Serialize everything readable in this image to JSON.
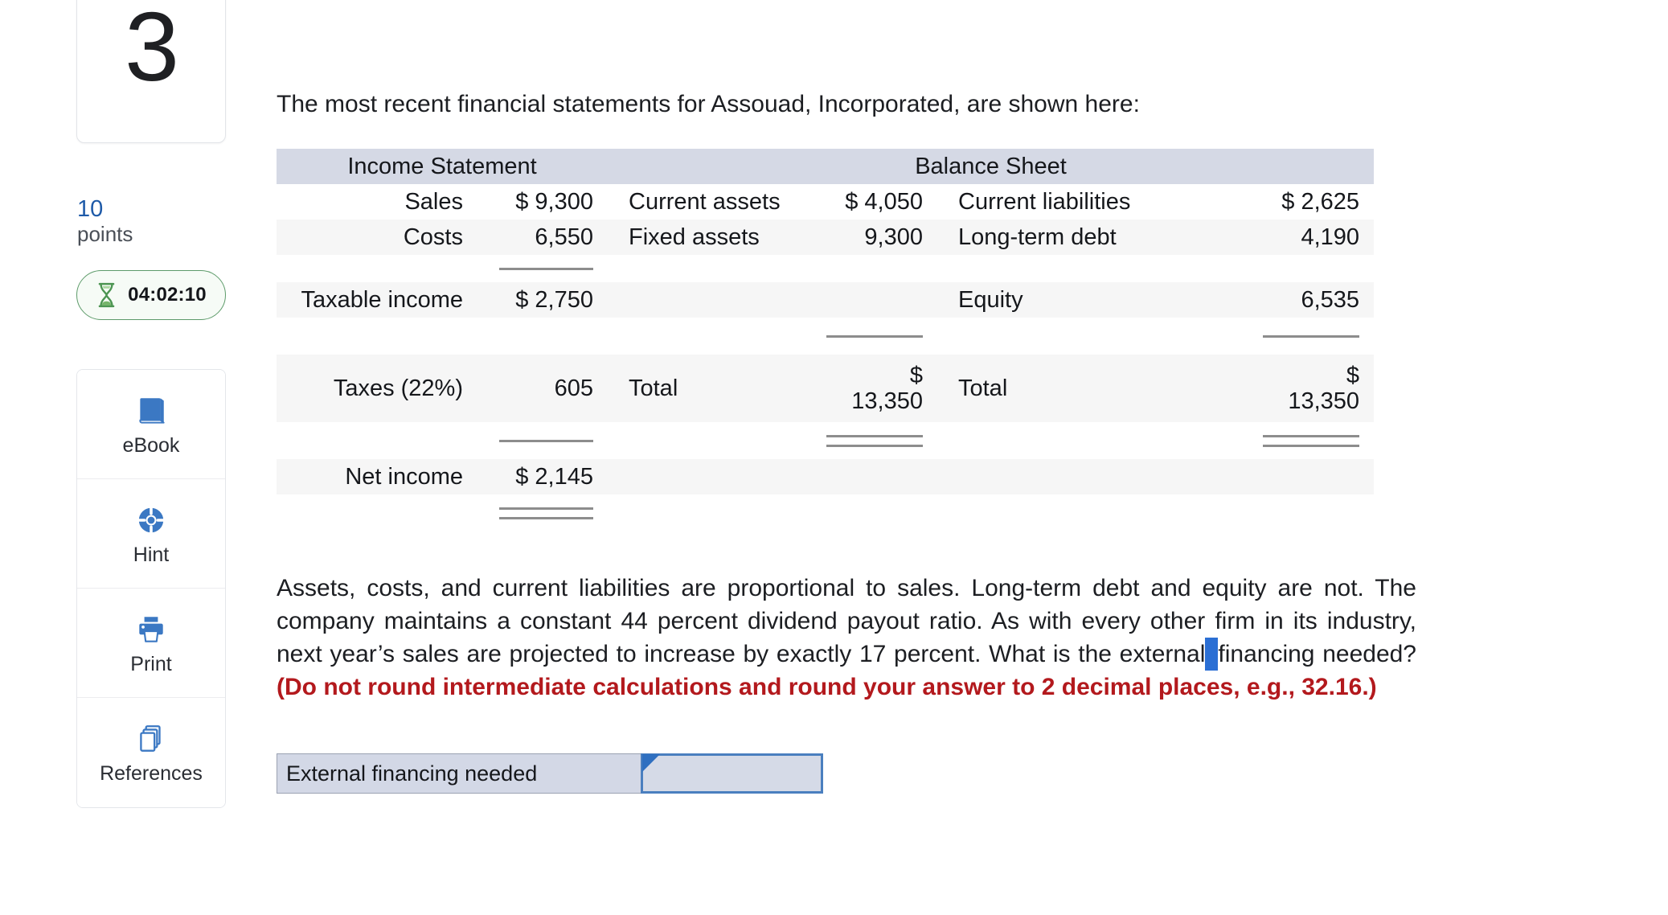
{
  "sidebar": {
    "question_number": "3",
    "points_value": "10",
    "points_label": "points",
    "timer": "04:02:10",
    "timer_icon": "hourglass-icon",
    "tools": [
      {
        "label": "eBook",
        "icon": "book-icon"
      },
      {
        "label": "Hint",
        "icon": "lifebuoy-icon"
      },
      {
        "label": "Print",
        "icon": "printer-icon"
      },
      {
        "label": "References",
        "icon": "documents-stack-icon"
      }
    ]
  },
  "main": {
    "intro": "The most recent financial statements for Assouad, Incorporated, are shown here:",
    "statement_table": {
      "headers": [
        "Income Statement",
        "Balance Sheet"
      ],
      "rows": [
        {
          "income_label": "Sales",
          "income_value": "$ 9,300",
          "asset_label": "Current assets",
          "asset_value": "$ 4,050",
          "liab_label": "Current liabilities",
          "liab_value": "$ 2,625"
        },
        {
          "income_label": "Costs",
          "income_value": "6,550",
          "asset_label": "Fixed assets",
          "asset_value": "9,300",
          "liab_label": "Long-term debt",
          "liab_value": "4,190"
        },
        {
          "income_label": "Taxable income",
          "income_value": "$ 2,750",
          "asset_label": "",
          "asset_value": "",
          "liab_label": "Equity",
          "liab_value": "6,535"
        },
        {
          "income_label": "Taxes (22%)",
          "income_value": "605",
          "asset_label": "Total",
          "asset_value_line1": "$",
          "asset_value_line2": "13,350",
          "liab_label": "Total",
          "liab_value_line1": "$",
          "liab_value_line2": "13,350"
        },
        {
          "income_label": "Net income",
          "income_value": "$ 2,145",
          "asset_label": "",
          "asset_value": "",
          "liab_label": "",
          "liab_value": ""
        }
      ]
    },
    "question_part1": "Assets, costs, and current liabilities are proportional to sales. Long-term debt and equity are not. The company maintains a constant 44 percent dividend payout ratio. As with every other firm in its industry, next year’s sales are projected to increase by exactly 17 percent. What is the external",
    "question_part2": "financing needed?",
    "question_note": "(Do not round intermediate calculations and round your answer to 2 decimal places, e.g., 32.16.)",
    "answer": {
      "label": "External financing needed",
      "value": "",
      "placeholder": ""
    }
  },
  "colors": {
    "accent_blue": "#1e5aa8",
    "icon_blue": "#3b78c3",
    "timer_green": "#5d9b6a",
    "note_red": "#b3191d",
    "table_header": "#d5d9e5",
    "selection_blue": "#2b6fd4"
  }
}
